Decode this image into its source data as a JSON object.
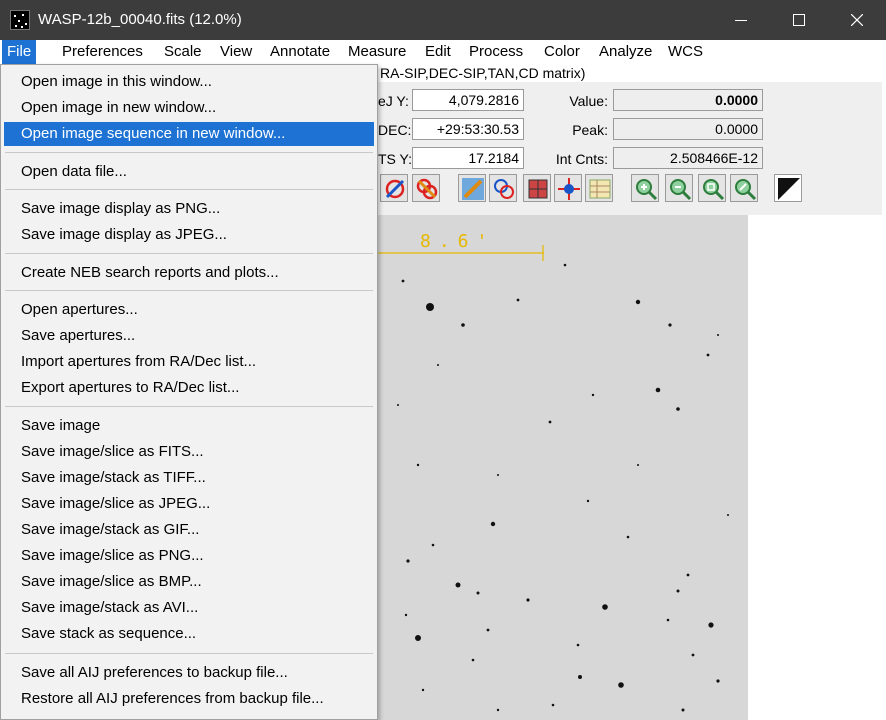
{
  "window": {
    "title": "WASP-12b_00040.fits (12.0%)",
    "minimize_glyph": "minimize-icon",
    "maximize_glyph": "maximize-icon",
    "close_glyph": "close-icon"
  },
  "menubar": {
    "items": [
      "File",
      "Preferences",
      "Scale",
      "View",
      "Annotate",
      "Measure",
      "Edit",
      "Process",
      "Color",
      "Analyze",
      "WCS"
    ],
    "active": "File"
  },
  "wcs_info": "RA-SIP,DEC-SIP,TAN,CD matrix)",
  "readouts": {
    "row1": {
      "label_left": "eJ Y:",
      "value_left": "4,079.2816",
      "label_right": "Value:",
      "value_right": "0.0000"
    },
    "row2": {
      "label_left": "DEC:",
      "value_left": "+29:53:30.53",
      "label_right": "Peak:",
      "value_right": "0.0000"
    },
    "row3": {
      "label_left": "TS Y:",
      "value_left": "17.2184",
      "label_right": "Int Cnts:",
      "value_right": "2.508466E-12"
    }
  },
  "image": {
    "scale_label": "8.6'",
    "scale_color": "#e6b800"
  },
  "file_menu": {
    "groups": [
      [
        "Open image in this window...",
        "Open image in new window...",
        "Open image sequence in new window..."
      ],
      [
        "Open data file..."
      ],
      [
        "Save image display as PNG...",
        "Save image display as JPEG..."
      ],
      [
        "Create NEB search reports and plots..."
      ],
      [
        "Open apertures...",
        "Save apertures...",
        "Import apertures from RA/Dec list...",
        "Export apertures to RA/Dec list..."
      ],
      [
        "Save image",
        "Save image/slice as FITS...",
        "Save image/stack as TIFF...",
        "Save image/slice as JPEG...",
        "Save image/stack as GIF...",
        "Save image/slice as PNG...",
        "Save image/slice as BMP...",
        "Save image/stack as AVI...",
        "Save stack as sequence..."
      ],
      [
        "Save all AIJ preferences to backup file...",
        "Restore all AIJ preferences from backup file..."
      ]
    ],
    "highlighted": "Open image sequence in new window..."
  },
  "colors": {
    "titlebar": "#3c3c3c",
    "menu_highlight": "#1d72d4",
    "image_background": "#d7d7d7"
  }
}
